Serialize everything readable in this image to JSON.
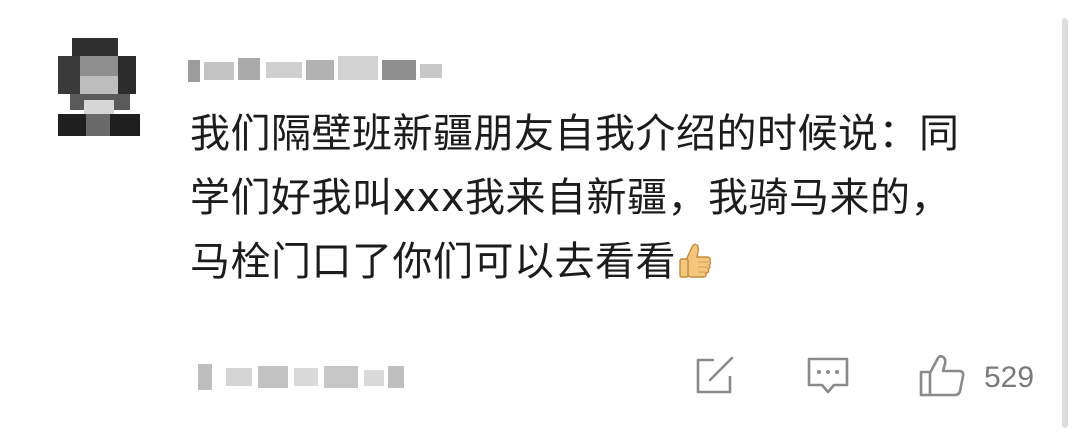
{
  "comment": {
    "username": "",
    "text": "我们隔壁班新疆朋友自我介绍的时候说：同\n学们好我叫xxx我来自新疆，我骑马来的，\n马栓门口了你们可以去看看",
    "emoji": "thumbs-up-emoji",
    "meta": ""
  },
  "actions": {
    "share_icon": "share-icon",
    "reply_icon": "comment-icon",
    "like_icon": "thumbs-up-icon",
    "like_count": "529"
  },
  "colors": {
    "text": "#1c1c1c",
    "muted": "#7a7a7a",
    "icon": "#8a8a8a"
  }
}
